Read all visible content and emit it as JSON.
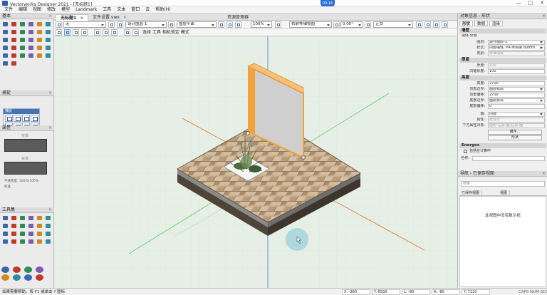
{
  "window": {
    "title": "Vectorworks Designer 2021 - [无标题1]",
    "controls": [
      "—",
      "□",
      "✕"
    ],
    "bubble_text": "00:16"
  },
  "menu": [
    "文件",
    "编辑",
    "视图",
    "修改",
    "模型",
    "Landmark",
    "工具",
    "文本",
    "窗口",
    "云",
    "帮助(H)"
  ],
  "doc_tabs": {
    "active": "无标题1",
    "other": "文件设置.vwx",
    "close": "×",
    "resource_manager": "资源管理器"
  },
  "viewbar1": {
    "class": "无",
    "layer": "设计图层-1",
    "view": "图层平面",
    "scale": "100%",
    "render": "右前等轴视图",
    "angle": "0.00°",
    "projection": "正交"
  },
  "viewbar2": {
    "modes": "选择  工具  相机锁定  模式"
  },
  "left": {
    "basic_title": "基本",
    "snap_title": "捕捉",
    "attr_title": "属性",
    "attr_solid": "实体",
    "attr_opacity": "不透明度: 100%/100%",
    "attr_marker": "标准",
    "toolset_title": "工具集",
    "panel_close": "×"
  },
  "status": {
    "hint": "如果需要帮助，按 F1 或单击 ? 图标",
    "x": "X: -260",
    "y": "Y: 6530",
    "l": "L: -80",
    "angle": "A: -80",
    "z": "Y: 7110",
    "caps": "CAPS NUM SCRL"
  },
  "obj_info": {
    "title": "对象信息 - 形状",
    "tabs": [
      "形状",
      "数据",
      "渲染"
    ],
    "object_type": "墙壁",
    "object_sub": "墙体-外部",
    "layer_label": "图层:",
    "layer_value": "设计图层-1",
    "style_label": "样式:",
    "style_value": "内部墙体, PR-木构架 80mm",
    "class_label": "类别:",
    "class_value": "标准墙体",
    "thickness_section": "厚度",
    "thickness_label": "厚度:",
    "thickness_value": "100",
    "core_label": "同轴厚度:",
    "core_value": "100",
    "height_section": "高度",
    "height_label": "高度:",
    "height_value": "2700",
    "top_bound_label": "顶部边界:",
    "top_bound_value": "图层标高",
    "top_offset_label": "顶部偏移:",
    "top_offset_value": "2700",
    "bot_bound_label": "底部边界:",
    "bot_bound_value": "图层标高",
    "bot_offset_label": "底部偏移:",
    "bot_offset_value": "0",
    "cap_label": "端:",
    "cap_value": "内部",
    "texture_label": "属性:",
    "texture_value": "建议行",
    "elements_label": "下方属性对象:",
    "elements_value": "图形-右前-面/右前-面",
    "component_button": "组件...",
    "energy_button": "形状",
    "energos_section": "Energos",
    "energos_check": "包括在计算中",
    "name_label": "名称:"
  },
  "navigation": {
    "title": "导航 - 已保存视图",
    "search": "搜索",
    "col1": "已保存视图",
    "col2": "视图",
    "empty": "此视图中没有数示视"
  },
  "icons": {
    "basic_palette": [
      "select-arrow-icon",
      "pan-hand-icon",
      "zoom-icon",
      "flyover-icon",
      "line-icon",
      "polyline-icon",
      "rectangle-icon",
      "circle-icon",
      "arc-icon",
      "polygon-icon",
      "text-icon",
      "callout-icon",
      "dimension-icon",
      "eyedropper-icon",
      "cube-icon",
      "wall-icon"
    ],
    "snap_palette": [
      "snap-grid-icon",
      "snap-object-icon",
      "snap-angle-icon",
      "snap-intersect-icon",
      "snap-distance-icon",
      "snap-tangent-icon",
      "snap-surface-icon",
      "snap-work-plane-icon"
    ],
    "toolset": [
      "building-shell-icon",
      "furniture-icon",
      "site-plant-icon",
      "dims-icon",
      "detail-icon",
      "visualization-icon",
      "landmark-icon",
      "fence-icon",
      "3d-modeling-icon",
      "machine-icon",
      "window-icon",
      "door-icon"
    ],
    "toolset_bottom": [
      "set-globe-icon",
      "architect-icon",
      "landscape-icon",
      "spotlight-icon"
    ]
  },
  "colors": {
    "wall_highlight": "#f0a03a",
    "wall_face": "#cfcfcf",
    "paving_light": "#cdb595",
    "paving_dark": "#a88d6a",
    "soil": "#5a4a3a",
    "canvas_bg": "#e6efe5",
    "axis_red": "#e56f3a",
    "axis_green": "#5fcc6a",
    "axis_blue": "#5a6fe0",
    "accent_blue": "#2c6ed6"
  }
}
